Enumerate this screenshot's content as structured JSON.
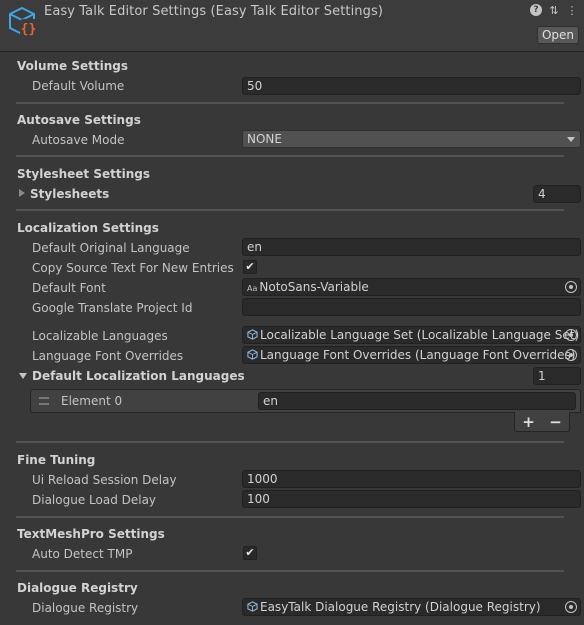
{
  "window": {
    "title": "Easy Talk Editor Settings (Easy Talk Editor Settings)",
    "open_label": "Open",
    "help_icon": "?",
    "settings_icon": "⇅",
    "menu_icon": "⋮"
  },
  "volume": {
    "title": "Volume Settings",
    "default_volume_label": "Default Volume",
    "default_volume_value": "50"
  },
  "autosave": {
    "title": "Autosave Settings",
    "mode_label": "Autosave Mode",
    "mode_value": "NONE"
  },
  "stylesheet": {
    "title": "Stylesheet Settings",
    "stylesheets_label": "Stylesheets",
    "stylesheets_count": "4"
  },
  "localization": {
    "title": "Localization Settings",
    "original_language_label": "Default Original Language",
    "original_language_value": "en",
    "copy_source_label": "Copy Source Text For New Entries",
    "copy_source_checked": "✔",
    "default_font_label": "Default Font",
    "default_font_value": "NotoSans-Variable",
    "font_icon_text": "Aa",
    "google_project_label": "Google Translate Project Id",
    "google_project_value": "",
    "localizable_languages_label": "Localizable Languages",
    "localizable_languages_value": "Localizable Language Set (Localizable Language Set)",
    "font_overrides_label": "Language Font Overrides",
    "font_overrides_value": "Language Font Overrides (Language Font Overrides)",
    "default_languages_label": "Default Localization Languages",
    "default_languages_count": "1",
    "elements": [
      {
        "label": "Element 0",
        "value": "en"
      }
    ],
    "add_label": "+",
    "remove_label": "−"
  },
  "fine_tuning": {
    "title": "Fine Tuning",
    "reload_delay_label": "Ui Reload Session Delay",
    "reload_delay_value": "1000",
    "load_delay_label": "Dialogue Load Delay",
    "load_delay_value": "100"
  },
  "tmp": {
    "title": "TextMeshPro Settings",
    "auto_detect_label": "Auto Detect TMP",
    "auto_detect_checked": "✔"
  },
  "registry": {
    "title": "Dialogue Registry",
    "registry_label": "Dialogue Registry",
    "registry_value": "EasyTalk Dialogue Registry (Dialogue Registry)"
  },
  "colors": {
    "background": "#383838",
    "field": "#2a2a2a",
    "logo_blue": "#3ea6e8",
    "logo_orange": "#e8662b"
  }
}
